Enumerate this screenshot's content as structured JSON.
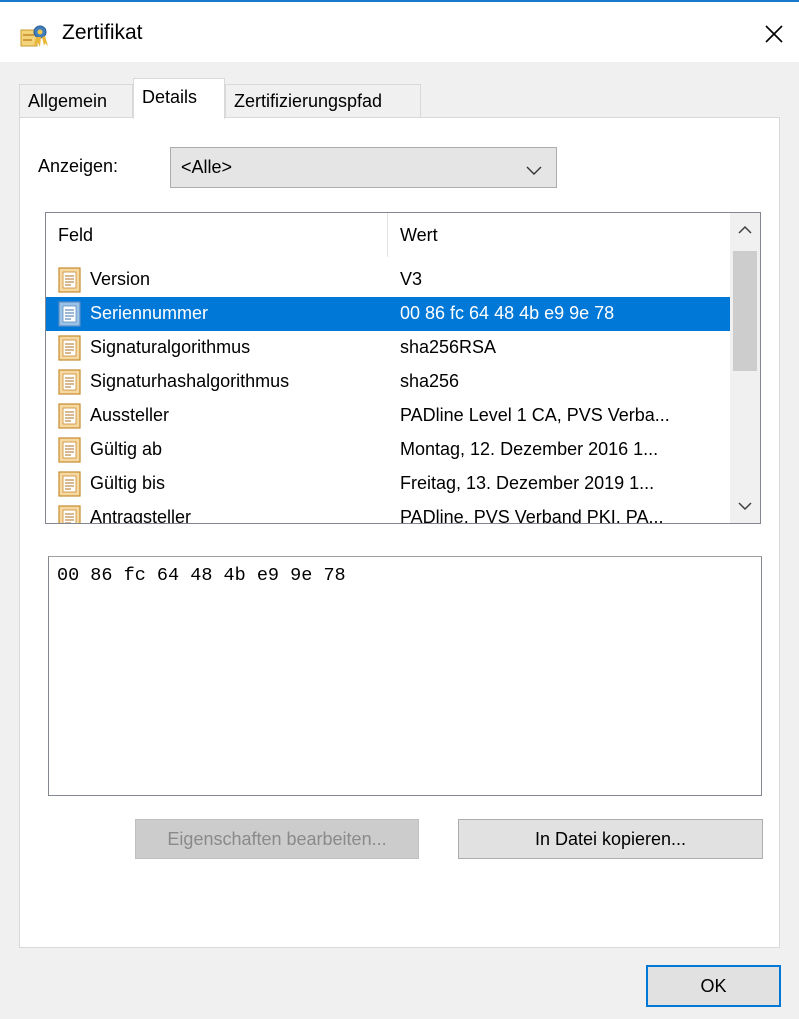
{
  "window": {
    "title": "Zertifikat",
    "app_icon": "certificate-icon",
    "close_icon": "close-icon"
  },
  "tabs": [
    {
      "label": "Allgemein",
      "active": false
    },
    {
      "label": "Details",
      "active": true
    },
    {
      "label": "Zertifizierungspfad",
      "active": false
    }
  ],
  "show": {
    "label": "Anzeigen:",
    "selected": "<Alle>"
  },
  "list": {
    "columns": [
      "Feld",
      "Wert"
    ],
    "rows": [
      {
        "field": "Version",
        "value": "V3",
        "selected": false
      },
      {
        "field": "Seriennummer",
        "value": "00 86 fc 64 48 4b e9 9e 78",
        "selected": true
      },
      {
        "field": "Signaturalgorithmus",
        "value": "sha256RSA",
        "selected": false
      },
      {
        "field": "Signaturhashalgorithmus",
        "value": "sha256",
        "selected": false
      },
      {
        "field": "Aussteller",
        "value": "PADline Level 1 CA, PVS Verba...",
        "selected": false
      },
      {
        "field": "Gültig ab",
        "value": "Montag, 12. Dezember 2016 1...",
        "selected": false
      },
      {
        "field": "Gültig bis",
        "value": "Freitag, 13. Dezember 2019 1...",
        "selected": false
      },
      {
        "field": "Antragsteller",
        "value": "PADline, PVS Verband PKI, PA...",
        "selected": false
      }
    ]
  },
  "detail": {
    "text": "00 86 fc 64 48 4b e9 9e 78"
  },
  "buttons": {
    "edit_properties": {
      "label": "Eigenschaften bearbeiten...",
      "enabled": false
    },
    "copy_to_file": {
      "label": "In Datei kopieren...",
      "enabled": true
    },
    "ok": {
      "label": "OK"
    }
  },
  "colors": {
    "selection": "#0078d7",
    "accent": "#1979ca"
  }
}
